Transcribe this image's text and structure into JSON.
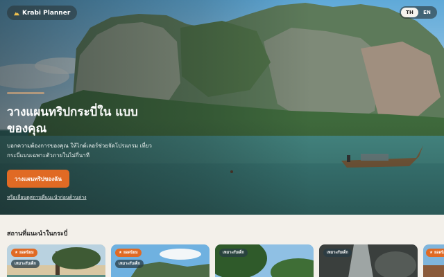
{
  "header": {
    "brand": "Krabi Planner",
    "brand_icon": "mountain-icon",
    "languages": [
      {
        "label": "TH",
        "active": true
      },
      {
        "label": "EN",
        "active": false
      }
    ]
  },
  "hero": {
    "title": "วางแผนทริปกระบี่ใน แบบของคุณ",
    "subtitle": "บอกความต้องการของคุณ ให้ไกด์เลอร์ช่วยจัดโปรแกรม เที่ยวกระบี่แบบเฉพาะตัวภายในไม่กี่นาที",
    "cta_label": "วางแผนทริปของฉัน",
    "secondary_link": "หรือเลื่อนดูสถานที่แนะนำก่อนด้านล่าง"
  },
  "recommended": {
    "title": "สถานที่แนะนำในกระบี่",
    "cards": [
      {
        "badges": [
          "ยอดนิยม",
          "เหมาะกับเด็ก"
        ],
        "scene": "tree-sunset"
      },
      {
        "badges": [
          "ยอดนิยม",
          "เหมาะกับเด็ก"
        ],
        "scene": "beach-sky"
      },
      {
        "badges": [
          "เหมาะกับเด็ก"
        ],
        "scene": "forest"
      },
      {
        "badges": [
          "เหมาะกับเด็ก"
        ],
        "scene": "waterfall"
      },
      {
        "badges": [
          "ยอดนิยม"
        ],
        "scene": "cliff"
      }
    ]
  },
  "colors": {
    "accent": "#e06a24",
    "page_bg": "#f3f0ea"
  }
}
